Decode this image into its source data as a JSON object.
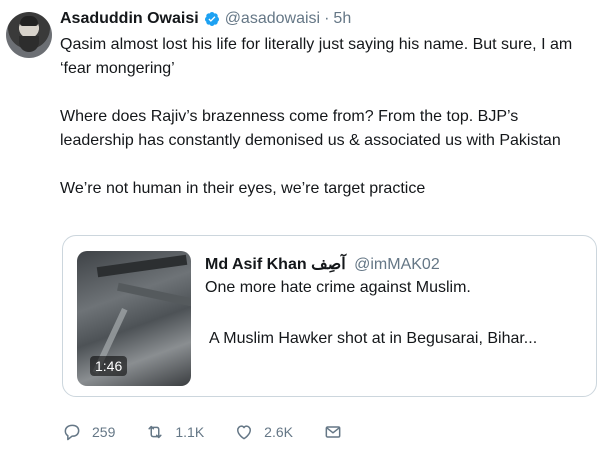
{
  "tweet": {
    "author_name": "Asaduddin Owaisi",
    "handle": "@asadowaisi",
    "separator": "·",
    "time": "5h",
    "paragraphs": [
      "Qasim almost lost his life for literally just saying his name. But sure, I am ‘fear mongering’",
      "Where does Rajiv’s brazenness come from? From the top. BJP’s leadership has constantly demonised us & associated us with Pakistan",
      "We’re not human in their eyes, we’re target practice"
    ]
  },
  "quoted": {
    "author_name": "Md Asif Khan آصِف",
    "handle": "@imMAK02",
    "line1": "One more hate crime against Muslim.",
    "line2": "A Muslim Hawker shot at in Begusarai, Bihar...",
    "video_duration": "1:46"
  },
  "actions": {
    "replies": "259",
    "retweets": "1.1K",
    "likes": "2.6K"
  },
  "icons": {
    "verified": "verified-badge-icon",
    "reply": "reply-icon",
    "retweet": "retweet-icon",
    "like": "heart-icon",
    "dm": "envelope-icon"
  },
  "colors": {
    "verified": "#1da1f2",
    "secondary_text": "#657786",
    "border": "#ccd6dd"
  }
}
